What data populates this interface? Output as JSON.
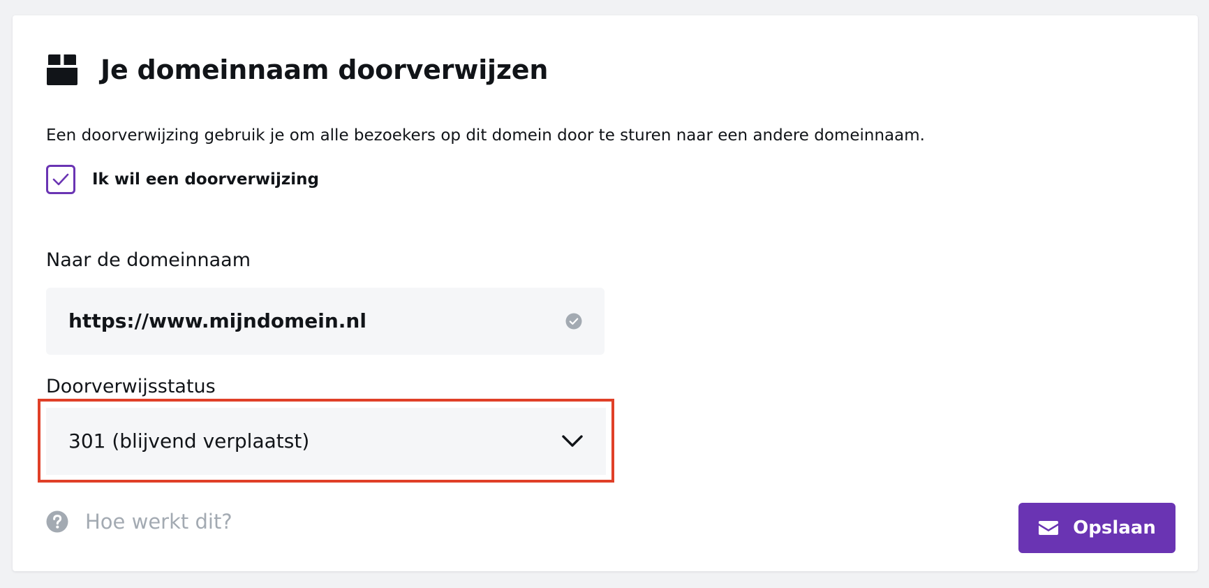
{
  "header": {
    "icon": "box-icon",
    "title": "Je domeinnaam doorverwijzen"
  },
  "description": "Een doorverwijzing gebruik je om alle bezoekers op dit domein door te sturen naar een andere domeinnaam.",
  "redirect_checkbox": {
    "checked": true,
    "label": "Ik wil een doorverwijzing"
  },
  "domain_field": {
    "label": "Naar de domeinnaam",
    "value": "https://www.mijndomein.nl",
    "status_icon": "check-circle-icon"
  },
  "status_field": {
    "label": "Doorverwijsstatus",
    "selected": "301 (blijvend verplaatst)",
    "icon": "chevron-down-icon"
  },
  "help": {
    "icon": "question-circle-icon",
    "label": "Hoe werkt dit?"
  },
  "save_button": {
    "icon": "envelope-icon",
    "label": "Opslaan"
  },
  "colors": {
    "accent": "#6a34b3",
    "highlight": "#e04028",
    "muted": "#a3aab2",
    "field_bg": "#f5f6f8",
    "page_bg": "#f1f2f4"
  }
}
